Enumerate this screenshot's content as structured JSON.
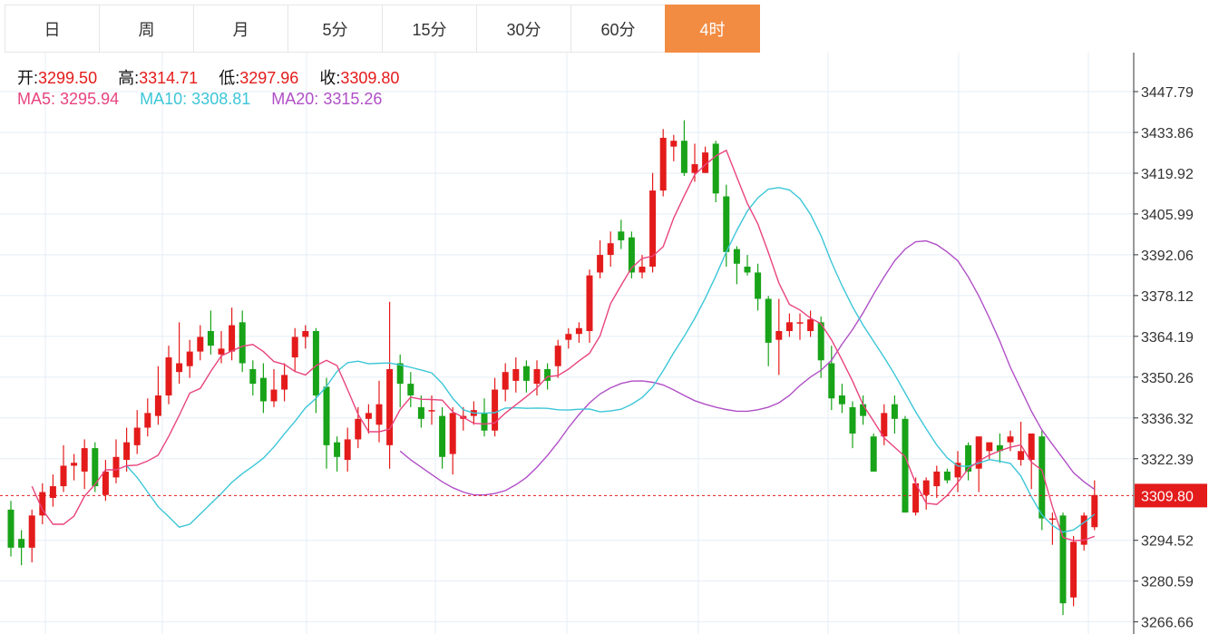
{
  "tabs": [
    {
      "label": "日",
      "active": false
    },
    {
      "label": "周",
      "active": false
    },
    {
      "label": "月",
      "active": false
    },
    {
      "label": "5分",
      "active": false
    },
    {
      "label": "15分",
      "active": false
    },
    {
      "label": "30分",
      "active": false
    },
    {
      "label": "60分",
      "active": false
    },
    {
      "label": "4时",
      "active": true
    }
  ],
  "ohlc_info": {
    "open_label": "开:",
    "open": "3299.50",
    "high_label": "高:",
    "high": "3314.71",
    "low_label": "低:",
    "low": "3297.96",
    "close_label": "收:",
    "close": "3309.80"
  },
  "ma_info": {
    "ma5_label": "MA5:",
    "ma5": "3295.94",
    "ma10_label": "MA10:",
    "ma10": "3308.81",
    "ma20_label": "MA20:",
    "ma20": "3315.26"
  },
  "colors": {
    "up": "#e41b1b",
    "down": "#18a318",
    "ma5": "#e8447e",
    "ma10": "#3cc6d8",
    "ma20": "#b04fc6",
    "active_tab": "#f28c43",
    "last_price_tag": "#e41b1b",
    "grid": "#e4eef6"
  },
  "chart_data": {
    "type": "candlestick",
    "y_ticks": [
      "3447.79",
      "3433.86",
      "3419.92",
      "3405.99",
      "3392.06",
      "3378.12",
      "3364.19",
      "3350.26",
      "3336.32",
      "3322.39",
      "3294.52",
      "3280.59",
      "3266.66"
    ],
    "last_price": "3309.80",
    "ylim": [
      3264,
      3465
    ],
    "grid": true,
    "candles": [
      [
        3305,
        3292,
        3308,
        3289
      ],
      [
        3295,
        3292,
        3298,
        3286
      ],
      [
        3292,
        3303,
        3305,
        3287
      ],
      [
        3303,
        3311,
        3314,
        3300
      ],
      [
        3309,
        3313,
        3317,
        3306
      ],
      [
        3313,
        3320,
        3327,
        3311
      ],
      [
        3320,
        3321,
        3324,
        3315
      ],
      [
        3318,
        3326,
        3329,
        3312
      ],
      [
        3326,
        3313,
        3328,
        3311
      ],
      [
        3310,
        3318,
        3322,
        3308
      ],
      [
        3316,
        3323,
        3329,
        3314
      ],
      [
        3322,
        3328,
        3333,
        3318
      ],
      [
        3327,
        3333,
        3339,
        3324
      ],
      [
        3333,
        3338,
        3343,
        3330
      ],
      [
        3337,
        3344,
        3354,
        3334
      ],
      [
        3344,
        3357,
        3361,
        3341
      ],
      [
        3352,
        3355,
        3369,
        3348
      ],
      [
        3354,
        3359,
        3363,
        3350
      ],
      [
        3359,
        3364,
        3368,
        3356
      ],
      [
        3366,
        3361,
        3373,
        3358
      ],
      [
        3358,
        3360,
        3366,
        3355
      ],
      [
        3359,
        3368,
        3374,
        3356
      ],
      [
        3369,
        3355,
        3373,
        3352
      ],
      [
        3353,
        3348,
        3356,
        3344
      ],
      [
        3350,
        3342,
        3355,
        3338
      ],
      [
        3342,
        3346,
        3353,
        3340
      ],
      [
        3346,
        3351,
        3355,
        3342
      ],
      [
        3357,
        3364,
        3367,
        3352
      ],
      [
        3364,
        3366,
        3368,
        3360
      ],
      [
        3366,
        3344,
        3367,
        3338
      ],
      [
        3347,
        3327,
        3350,
        3319
      ],
      [
        3328,
        3323,
        3330,
        3318
      ],
      [
        3322,
        3329,
        3333,
        3318
      ],
      [
        3329,
        3336,
        3340,
        3326
      ],
      [
        3336,
        3338,
        3341,
        3331
      ],
      [
        3334,
        3341,
        3349,
        3328
      ],
      [
        3327,
        3353,
        3376,
        3319
      ],
      [
        3355,
        3348,
        3358,
        3340
      ],
      [
        3348,
        3344,
        3352,
        3340
      ],
      [
        3340,
        3336,
        3344,
        3333
      ],
      [
        3339,
        3339,
        3344,
        3334
      ],
      [
        3337,
        3323,
        3340,
        3319
      ],
      [
        3324,
        3338,
        3340,
        3317
      ],
      [
        3336,
        3337,
        3340,
        3332
      ],
      [
        3337,
        3339,
        3342,
        3334
      ],
      [
        3338,
        3332,
        3343,
        3330
      ],
      [
        3332,
        3346,
        3350,
        3330
      ],
      [
        3346,
        3352,
        3355,
        3342
      ],
      [
        3349,
        3353,
        3357,
        3345
      ],
      [
        3354,
        3349,
        3356,
        3345
      ],
      [
        3348,
        3353,
        3356,
        3344
      ],
      [
        3353,
        3349,
        3355,
        3346
      ],
      [
        3354,
        3361,
        3363,
        3350
      ],
      [
        3363,
        3365,
        3367,
        3360
      ],
      [
        3365,
        3367,
        3369,
        3362
      ],
      [
        3366,
        3385,
        3387,
        3362
      ],
      [
        3386,
        3392,
        3397,
        3384
      ],
      [
        3392,
        3396,
        3400,
        3388
      ],
      [
        3400,
        3397,
        3404,
        3394
      ],
      [
        3398,
        3386,
        3400,
        3384
      ],
      [
        3386,
        3388,
        3392,
        3384
      ],
      [
        3388,
        3414,
        3420,
        3386
      ],
      [
        3414,
        3432,
        3435,
        3412
      ],
      [
        3429,
        3431,
        3433,
        3424
      ],
      [
        3431,
        3420,
        3438,
        3419
      ],
      [
        3420,
        3423,
        3430,
        3417
      ],
      [
        3420,
        3427,
        3429,
        3420
      ],
      [
        3430,
        3413,
        3431,
        3410
      ],
      [
        3412,
        3393,
        3416,
        3388
      ],
      [
        3394,
        3389,
        3395,
        3382
      ],
      [
        3388,
        3386,
        3392,
        3385
      ],
      [
        3386,
        3377,
        3389,
        3373
      ],
      [
        3377,
        3362,
        3378,
        3354
      ],
      [
        3363,
        3366,
        3377,
        3351
      ],
      [
        3366,
        3369,
        3372,
        3364
      ],
      [
        3369,
        3369,
        3372,
        3363
      ],
      [
        3366,
        3370,
        3373,
        3364
      ],
      [
        3369,
        3356,
        3371,
        3350
      ],
      [
        3355,
        3343,
        3361,
        3339
      ],
      [
        3344,
        3341,
        3348,
        3338
      ],
      [
        3340,
        3331,
        3342,
        3326
      ],
      [
        3341,
        3337,
        3344,
        3334
      ],
      [
        3330,
        3318,
        3331,
        3318
      ],
      [
        3330,
        3338,
        3341,
        3327
      ],
      [
        3341,
        3336,
        3344,
        3331
      ],
      [
        3336,
        3304,
        3337,
        3304
      ],
      [
        3304,
        3314,
        3316,
        3303
      ],
      [
        3310,
        3315,
        3316,
        3305
      ],
      [
        3313,
        3318,
        3320,
        3309
      ],
      [
        3318,
        3315,
        3319,
        3314
      ],
      [
        3316,
        3321,
        3325,
        3311
      ],
      [
        3327,
        3318,
        3328,
        3315
      ],
      [
        3319,
        3330,
        3330,
        3311
      ],
      [
        3325,
        3328,
        3328,
        3322
      ],
      [
        3327,
        3325,
        3331,
        3321
      ],
      [
        3328,
        3330,
        3332,
        3325
      ],
      [
        3322,
        3325,
        3335,
        3320
      ],
      [
        3322,
        3331,
        3331,
        3312
      ],
      [
        3330,
        3302,
        3332,
        3298
      ],
      [
        3302,
        3302,
        3304,
        3293
      ],
      [
        3303,
        3273,
        3304,
        3269
      ],
      [
        3275,
        3294,
        3296,
        3272
      ],
      [
        3293,
        3303,
        3304,
        3291
      ],
      [
        3299,
        3310,
        3315,
        3298
      ]
    ],
    "ma5": [
      3313.0,
      3305.0,
      3300.0,
      3300.0,
      3302.8,
      3309.6,
      3313.6,
      3318.6,
      3318.6,
      3320.0,
      3320.2,
      3321.6,
      3323.6,
      3330.0,
      3337.2,
      3344.8,
      3346.4,
      3352.2,
      3357.5,
      3359.2,
      3360.8,
      3361.4,
      3359.0,
      3355.6,
      3354.6,
      3352.2,
      3351.0,
      3354.2,
      3356.0,
      3354.2,
      3346.0,
      3337.6,
      3331.6,
      3331.6,
      3332.5,
      3339.2,
      3343.4,
      3342.7,
      3342.6,
      3342.4,
      3338.4,
      3336.5,
      3334.5,
      3334.2,
      3334.6,
      3338.0,
      3340.8,
      3343.6,
      3346.6,
      3350.4,
      3350.8,
      3353.0,
      3355.8,
      3358.4,
      3364.4,
      3375.4,
      3381.6,
      3387.6,
      3390.8,
      3391.6,
      3394.8,
      3404.6,
      3412.2,
      3419.4,
      3422.8,
      3425.8,
      3427.7,
      3418.6,
      3409.6,
      3402.6,
      3392.8,
      3382.4,
      3375.1,
      3373.2,
      3370.4,
      3368.5,
      3363.0,
      3356.1,
      3348.9,
      3340.8,
      3335.2,
      3329.5,
      3326.3,
      3323.1,
      3314.0,
      3307.2,
      3306.8,
      3309.9,
      3314.3,
      3319.0,
      3321.6,
      3323.6,
      3325.1,
      3326.3,
      3327.1,
      3321.2,
      3318.5,
      3306.0,
      3295.5,
      3294.4,
      3294.6,
      3295.9
    ],
    "ma10": [
      3320.0,
      3316.0,
      3311.0,
      3306.0,
      3302.6,
      3299.0,
      3300.0,
      3303.5,
      3307.0,
      3310.5,
      3314.3,
      3317.3,
      3319.8,
      3322.6,
      3326.4,
      3330.9,
      3335.1,
      3339.8,
      3343.0,
      3347.1,
      3352.2,
      3355.2,
      3355.7,
      3354.8,
      3355.0,
      3355.1,
      3354.4,
      3353.6,
      3352.7,
      3351.7,
      3348.1,
      3343.0,
      3339.1,
      3338.0,
      3338.0,
      3338.1,
      3339.7,
      3339.8,
      3339.6,
      3339.7,
      3339.6,
      3339.1,
      3339.0,
      3339.3,
      3339.4,
      3338.4,
      3338.7,
      3339.3,
      3341.0,
      3343.3,
      3346.9,
      3352.5,
      3358.6,
      3364.2,
      3370.3,
      3377.2,
      3384.8,
      3393.0,
      3400.4,
      3407.0,
      3411.5,
      3414.5,
      3415.0,
      3414.2,
      3411.2,
      3405.9,
      3398.6,
      3389.5,
      3381.5,
      3374.3,
      3368.0,
      3362.5,
      3357.0,
      3351.2,
      3344.8,
      3338.4,
      3332.6,
      3327.1,
      3322.7,
      3319.9,
      3319.8,
      3320.9,
      3322.1,
      3321.5,
      3320.8,
      3316.5,
      3309.4,
      3303.2,
      3299.6,
      3297.3,
      3298.1,
      3300.6,
      3303.4
    ],
    "ma20": [
      3325.0,
      3322.0,
      3319.5,
      3317.0,
      3314.5,
      3312.5,
      3311.0,
      3310.0,
      3310.0,
      3310.5,
      3311.5,
      3313.5,
      3316.0,
      3319.5,
      3323.5,
      3328.0,
      3333.0,
      3337.5,
      3341.5,
      3344.5,
      3346.6,
      3348.1,
      3348.9,
      3349.0,
      3348.5,
      3347.6,
      3345.9,
      3344.0,
      3342.2,
      3341.0,
      3340.0,
      3339.2,
      3338.6,
      3338.6,
      3339.1,
      3340.0,
      3341.5,
      3344.0,
      3347.4,
      3350.3,
      3352.6,
      3356.0,
      3361.5,
      3366.5,
      3372.2,
      3378.6,
      3384.5,
      3390.0,
      3394.0,
      3396.5,
      3396.8,
      3395.5,
      3393.0,
      3390.0,
      3384.5,
      3378.0,
      3370.5,
      3362.5,
      3353.6,
      3346.1,
      3338.6,
      3332.2,
      3327.3,
      3322.5,
      3317.6,
      3314.5,
      3311.9
    ]
  }
}
